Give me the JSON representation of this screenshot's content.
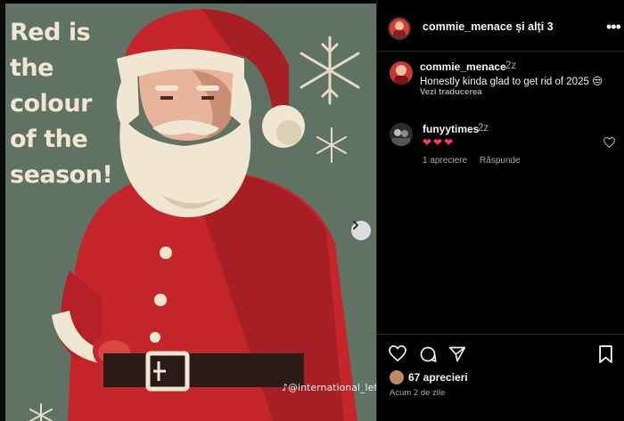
{
  "poster": {
    "line1": "Red is",
    "line2": "the",
    "line3": "colour",
    "line4": "of the",
    "line5": "season!",
    "watermark": "@international_leftis"
  },
  "header": {
    "username": "commie_menace",
    "others": " și alți 3",
    "more_icon": "more-icon"
  },
  "comments": [
    {
      "username": "commie_menace",
      "time": "2z",
      "text": "Honestly kinda glad to get rid of 2025 😒",
      "translate": "Vezi traducerea"
    },
    {
      "username": "funyytimes",
      "time": "2z",
      "text": "❤❤❤",
      "likes": "1 apreciere",
      "reply": "Răspunde"
    }
  ],
  "footer": {
    "likes": "67 aprecieri",
    "time_ago": "Acum 2 de zile"
  },
  "colors": {
    "poster_bg": "#5f7264",
    "santa_red": "#c4262b",
    "cream": "#f0e6d2",
    "heart": "#ff3b5c"
  }
}
